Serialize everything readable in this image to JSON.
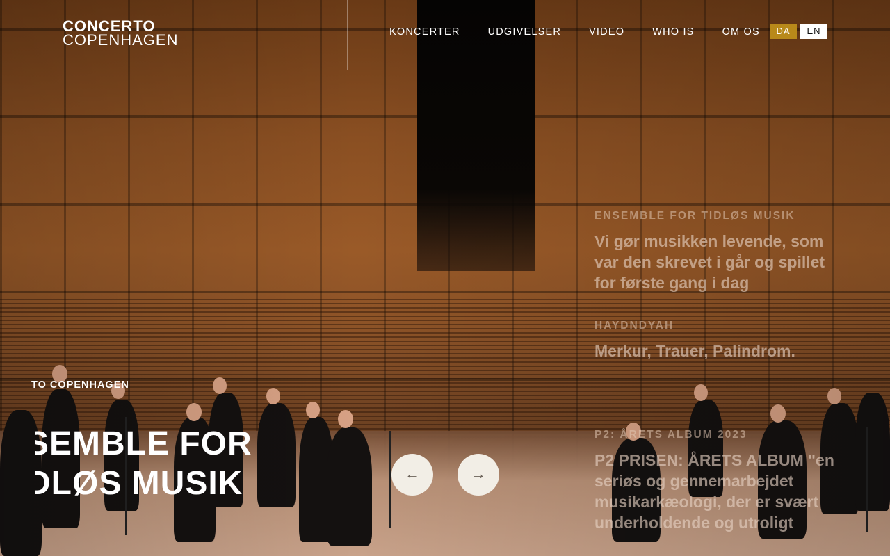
{
  "brand": {
    "line1": "CONCERTO",
    "line2": "COPENHAGEN"
  },
  "nav": {
    "items": [
      "KONCERTER",
      "UDGIVELSER",
      "VIDEO",
      "WHO IS",
      "OM OS"
    ]
  },
  "languages": {
    "da": "DA",
    "en": "EN",
    "active": "DA",
    "active_color": "#b8891a"
  },
  "hero": {
    "kicker": "TO COPENHAGEN",
    "title_line1": "SEMBLE FOR",
    "title_line2": "DLØS MUSIK"
  },
  "carousel": {
    "prev_icon": "arrow-left-icon",
    "next_icon": "arrow-right-icon",
    "prev_glyph": "←",
    "next_glyph": "→"
  },
  "slides": [
    {
      "kicker": "ENSEMBLE FOR TIDLØS MUSIK",
      "headline": "Vi gør musikken levende, som var den skrevet i går og spillet for første gang i dag"
    },
    {
      "kicker": "HAYDNDYAH",
      "headline": "Merkur, Trauer, Palindrom."
    },
    {
      "kicker": "P2: ÅRETS ALBUM 2023",
      "headline": "P2 PRISEN: ÅRETS ALBUM \"en seriøs og gennemarbejdet musikarkæologi, der er svært underholdende og utroligt"
    }
  ]
}
